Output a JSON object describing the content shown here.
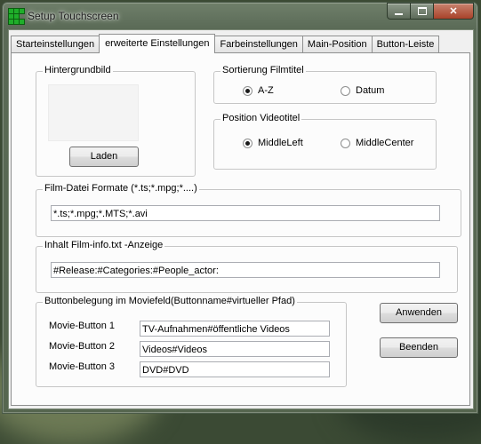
{
  "window": {
    "title": "Setup Touchscreen"
  },
  "tabs": [
    {
      "label": "Starteinstellungen"
    },
    {
      "label": "erweiterte Einstellungen"
    },
    {
      "label": "Farbeinstellungen"
    },
    {
      "label": "Main-Position"
    },
    {
      "label": "Button-Leiste"
    }
  ],
  "hintergrund": {
    "legend": "Hintergrundbild",
    "load_label": "Laden"
  },
  "sortierung": {
    "legend": "Sortierung Filmtitel",
    "options": [
      {
        "label": "A-Z",
        "selected": true
      },
      {
        "label": "Datum",
        "selected": false
      }
    ]
  },
  "position": {
    "legend": "Position Videotitel",
    "options": [
      {
        "label": "MiddleLeft",
        "selected": true
      },
      {
        "label": "MiddleCenter",
        "selected": false
      }
    ]
  },
  "filmformate": {
    "legend": "Film-Datei Formate (*.ts;*.mpg;*....)",
    "value": "*.ts;*.mpg;*.MTS;*.avi"
  },
  "filminfo": {
    "legend": "Inhalt Film-info.txt -Anzeige",
    "value": "#Release:#Categories:#People_actor:"
  },
  "buttonbelegung": {
    "legend": "Buttonbelegung im Moviefeld(Buttonname#virtueller Pfad)",
    "rows": [
      {
        "label": "Movie-Button 1",
        "value": "TV-Aufnahmen#öffentliche Videos"
      },
      {
        "label": "Movie-Button 2",
        "value": "Videos#Videos"
      },
      {
        "label": "Movie-Button 3",
        "value": "DVD#DVD"
      }
    ]
  },
  "actions": {
    "apply_label": "Anwenden",
    "quit_label": "Beenden"
  }
}
